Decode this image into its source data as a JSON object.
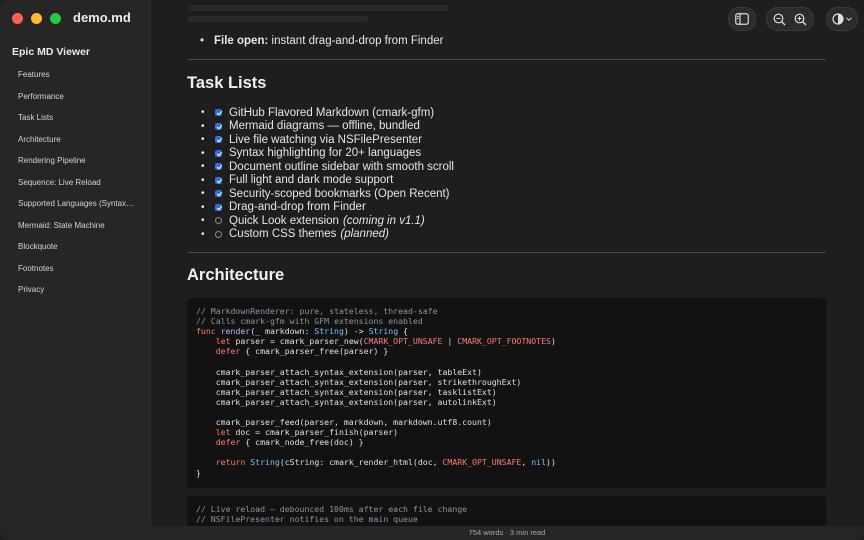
{
  "window": {
    "title": "demo.md"
  },
  "sidebar": {
    "app_name": "Epic MD Viewer",
    "items": [
      {
        "label": "Features"
      },
      {
        "label": "Performance"
      },
      {
        "label": "Task Lists"
      },
      {
        "label": "Architecture"
      },
      {
        "label": "Rendering Pipeline"
      },
      {
        "label": "Sequence: Live Reload"
      },
      {
        "label": "Supported Languages (Syntax Highlighting)"
      },
      {
        "label": "Mermaid: State Machine"
      },
      {
        "label": "Blockquote"
      },
      {
        "label": "Footnotes"
      },
      {
        "label": "Privacy"
      }
    ]
  },
  "toolbar": {
    "icons": [
      "sidebar-toggle-icon",
      "zoom-out-icon",
      "zoom-in-icon",
      "appearance-icon",
      "chevron-down-icon"
    ]
  },
  "content": {
    "top_bullet_bold": "File open:",
    "top_bullet_text": " instant drag-and-drop from Finder",
    "task_lists_heading": "Task Lists",
    "tasks": [
      {
        "text": "GitHub Flavored Markdown (cmark-gfm)",
        "done": true,
        "note": ""
      },
      {
        "text": "Mermaid diagrams — offline, bundled",
        "done": true,
        "note": ""
      },
      {
        "text": "Live file watching via NSFilePresenter",
        "done": true,
        "note": ""
      },
      {
        "text": "Syntax highlighting for 20+ languages",
        "done": true,
        "note": ""
      },
      {
        "text": "Document outline sidebar with smooth scroll",
        "done": true,
        "note": ""
      },
      {
        "text": "Full light and dark mode support",
        "done": true,
        "note": ""
      },
      {
        "text": "Security-scoped bookmarks (Open Recent)",
        "done": true,
        "note": ""
      },
      {
        "text": "Drag-and-drop from Finder",
        "done": true,
        "note": ""
      },
      {
        "text": "Quick Look extension",
        "done": false,
        "note": "(coming in v1.1)"
      },
      {
        "text": "Custom CSS themes",
        "done": false,
        "note": "(planned)"
      }
    ],
    "architecture_heading": "Architecture",
    "code1": [
      "// MarkdownRenderer: pure, stateless, thread-safe",
      "// Calls cmark-gfm with GFM extensions enabled",
      "func render(_ markdown: String) -> String {",
      "    let parser = cmark_parser_new(CMARK_OPT_UNSAFE | CMARK_OPT_FOOTNOTES)",
      "    defer { cmark_parser_free(parser) }",
      "",
      "    cmark_parser_attach_syntax_extension(parser, tableExt)",
      "    cmark_parser_attach_syntax_extension(parser, strikethroughExt)",
      "    cmark_parser_attach_syntax_extension(parser, tasklistExt)",
      "    cmark_parser_attach_syntax_extension(parser, autolinkExt)",
      "",
      "    cmark_parser_feed(parser, markdown, markdown.utf8.count)",
      "    let doc = cmark_parser_finish(parser)",
      "    defer { cmark_node_free(doc) }",
      "",
      "    return String(cString: cmark_render_html(doc, CMARK_OPT_UNSAFE, nil))",
      "}"
    ],
    "code2": [
      "// Live reload — debounced 100ms after each file change",
      "// NSFilePresenter notifies on the main queue"
    ]
  },
  "status": {
    "text": "754 words · 3 min read"
  },
  "colors": {
    "accent": "#2f6fd6",
    "background": "#1e1e1e",
    "sidebar": "#262626"
  }
}
